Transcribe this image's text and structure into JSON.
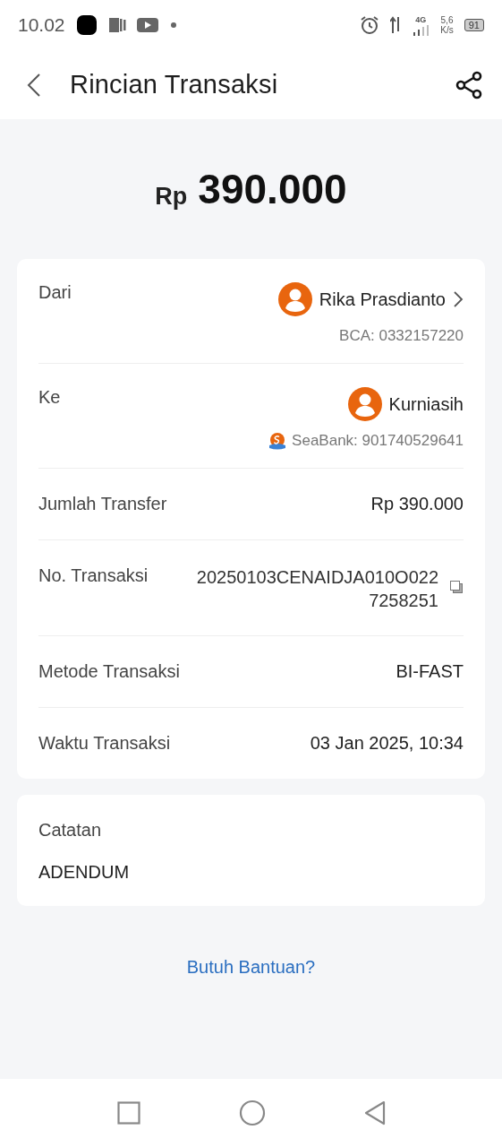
{
  "status_bar": {
    "time": "10.02",
    "network": "4G",
    "speed_value": "5,6",
    "speed_unit": "K/s",
    "battery": "91"
  },
  "header": {
    "title": "Rincian Transaksi"
  },
  "amount": {
    "currency": "Rp",
    "value": "390.000"
  },
  "details": [
    {
      "kind": "party",
      "label": "Dari",
      "name": "Rika Prasdianto",
      "account": "BCA: 0332157220",
      "has_chevron": true,
      "bank_logo": false
    },
    {
      "kind": "party",
      "label": "Ke",
      "name": "Kurniasih",
      "account": "SeaBank: 901740529641",
      "has_chevron": false,
      "bank_logo": true
    },
    {
      "kind": "text",
      "label": "Jumlah Transfer",
      "value": "Rp 390.000"
    },
    {
      "kind": "copy",
      "label": "No. Transaksi",
      "value": "20250103CENAIDJA010O0227258251"
    },
    {
      "kind": "text",
      "label": "Metode Transaksi",
      "value": "BI-FAST"
    },
    {
      "kind": "text",
      "label": "Waktu Transaksi",
      "value": "03 Jan 2025, 10:34"
    }
  ],
  "note": {
    "label": "Catatan",
    "value": "ADENDUM"
  },
  "help_link": "Butuh Bantuan?"
}
